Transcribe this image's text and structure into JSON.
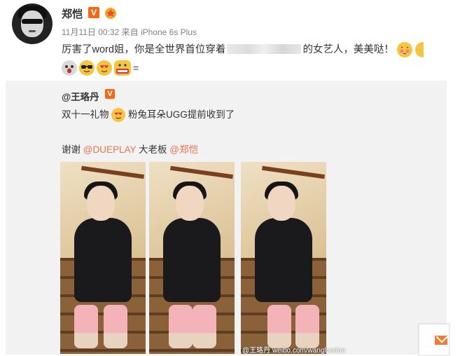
{
  "post": {
    "author": "郑恺",
    "verified_badge": "V",
    "time": "11月11日 00:32",
    "source": "来自 iPhone 6s Plus",
    "content_before": "厉害了word姐，你是全世界首位穿着",
    "content_after": "的女艺人，美美哒！",
    "trailing_text": "=",
    "emojis": [
      "shy-emoji",
      "wink-emoji",
      "surprised-emoji",
      "sunglasses-emoji",
      "heart-eyes-emoji",
      "awesome-emoji"
    ]
  },
  "repost": {
    "author": "@王珞丹",
    "verified_badge": "V",
    "text_before": "双十一礼物",
    "text_after": "粉兔耳朵UGG提前收到了",
    "thanks_prefix": "谢谢",
    "mention_1": "@DUEPLAY",
    "thanks_middle": "大老板",
    "mention_2": "@郑恺",
    "watermark": "weibo.com/wangluodan",
    "watermark_user": "@王珞丹"
  },
  "colors": {
    "link": "#eb7350",
    "verified": "#f26a19",
    "repost_bg": "#f2f2f2",
    "mail_button": "#f07b32"
  }
}
